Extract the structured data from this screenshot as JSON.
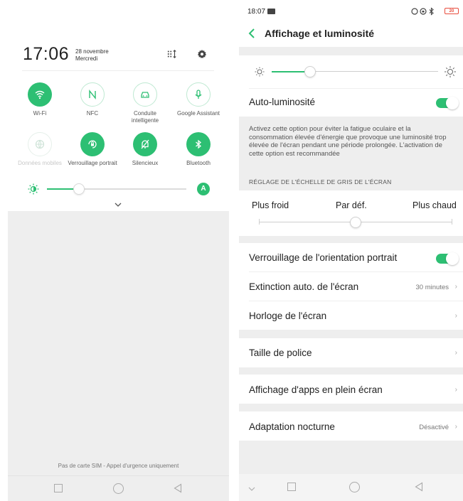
{
  "quick_settings": {
    "time": "17:06",
    "date": "28 novembre",
    "weekday": "Mercredi",
    "header_icons": [
      "grid-edit-icon",
      "gear-icon"
    ],
    "tiles": [
      {
        "label": "Wi-Fi",
        "icon": "wifi-icon",
        "state": "on"
      },
      {
        "label": "NFC",
        "icon": "nfc-icon",
        "state": "off"
      },
      {
        "label": "Conduite intelligente",
        "icon": "car-icon",
        "state": "off"
      },
      {
        "label": "Google Assistant",
        "icon": "microphone-icon",
        "state": "off"
      },
      {
        "label": "Données mobiles",
        "icon": "globe-icon",
        "state": "disabled"
      },
      {
        "label": "Verrouillage portrait",
        "icon": "rotation-lock-icon",
        "state": "on"
      },
      {
        "label": "Silencieux",
        "icon": "bell-off-icon",
        "state": "on"
      },
      {
        "label": "Bluetooth",
        "icon": "bluetooth-icon",
        "state": "on"
      }
    ],
    "brightness_level": 0.2,
    "auto_brightness_badge": "A",
    "sim_notice": "Pas de carte SIM - Appel d'urgence uniquement"
  },
  "settings": {
    "status_time": "18:07",
    "battery": "20",
    "title": "Affichage et luminosité",
    "brightness_level": 0.2,
    "auto_brightness": {
      "label": "Auto-luminosité",
      "enabled": true
    },
    "description": "Activez cette option pour éviter la fatigue oculaire et la consommation élevée d'énergie que provoque une luminosité trop élevée de l'écran pendant une période prolongée. L'activation de cette option est recommandée",
    "grayscale_section": "RÉGLAGE DE L'ÉCHELLE DE GRIS DE L'ÉCRAN",
    "grayscale": {
      "cold": "Plus froid",
      "default": "Par déf.",
      "warm": "Plus chaud",
      "level": 0.5
    },
    "rows": {
      "portrait_lock": {
        "label": "Verrouillage de l'orientation portrait",
        "enabled": true
      },
      "screen_timeout": {
        "label": "Extinction auto. de l'écran",
        "value": "30 minutes"
      },
      "screen_clock": {
        "label": "Horloge de l'écran"
      },
      "font_size": {
        "label": "Taille de police"
      },
      "fullscreen_apps": {
        "label": "Affichage d'apps en plein écran"
      },
      "night_mode": {
        "label": "Adaptation nocturne",
        "value": "Désactivé"
      }
    },
    "chevron": "›"
  },
  "colors": {
    "accent": "#2dbf73",
    "background": "#eeeeee"
  }
}
